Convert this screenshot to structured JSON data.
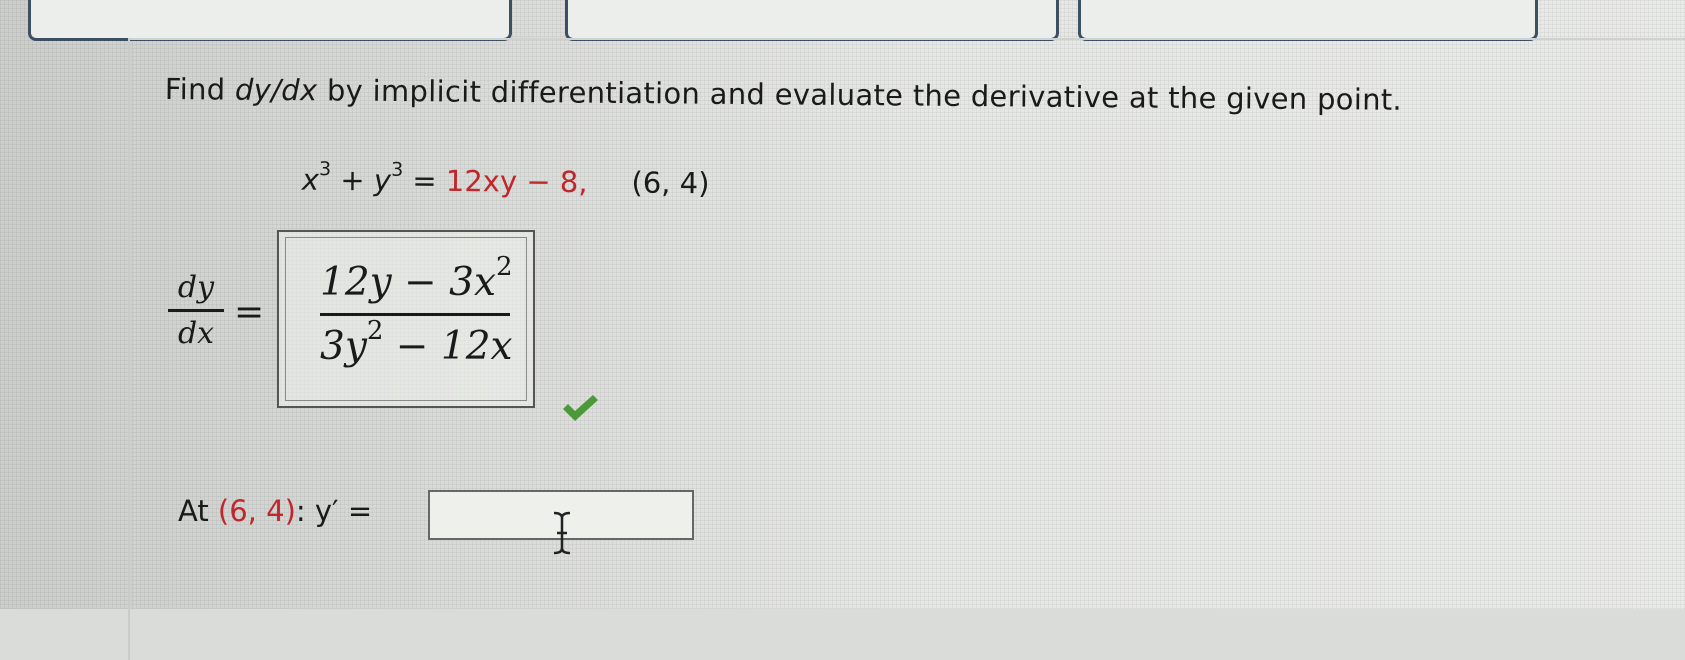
{
  "prompt": {
    "part1": "Find ",
    "dydx": "dy/dx",
    "part2": " by implicit differentiation and evaluate the derivative at the given point."
  },
  "equation": {
    "x": "x",
    "exp1": "3",
    "plus": " + ",
    "y": "y",
    "exp2": "3",
    "eq": " = ",
    "rhs": "12xy − 8,",
    "point": "(6, 4)"
  },
  "derivative": {
    "lhs_num": "dy",
    "lhs_den": "dx",
    "equals": "=",
    "answer_num_base": "12y − 3x",
    "answer_num_exp": "2",
    "answer_den_a": "3y",
    "answer_den_exp": "2",
    "answer_den_b": " − 12x",
    "status": "correct"
  },
  "evaluate": {
    "label_at": "At ",
    "point": "(6, 4)",
    "label_y": ": y′ = ",
    "input_value": ""
  },
  "colors": {
    "given_value": "#c0262b",
    "correct_mark": "#4a9a3a",
    "button_border": "#3c4f63"
  },
  "icons": {
    "check": "check-icon",
    "cursor": "text-cursor-icon"
  }
}
